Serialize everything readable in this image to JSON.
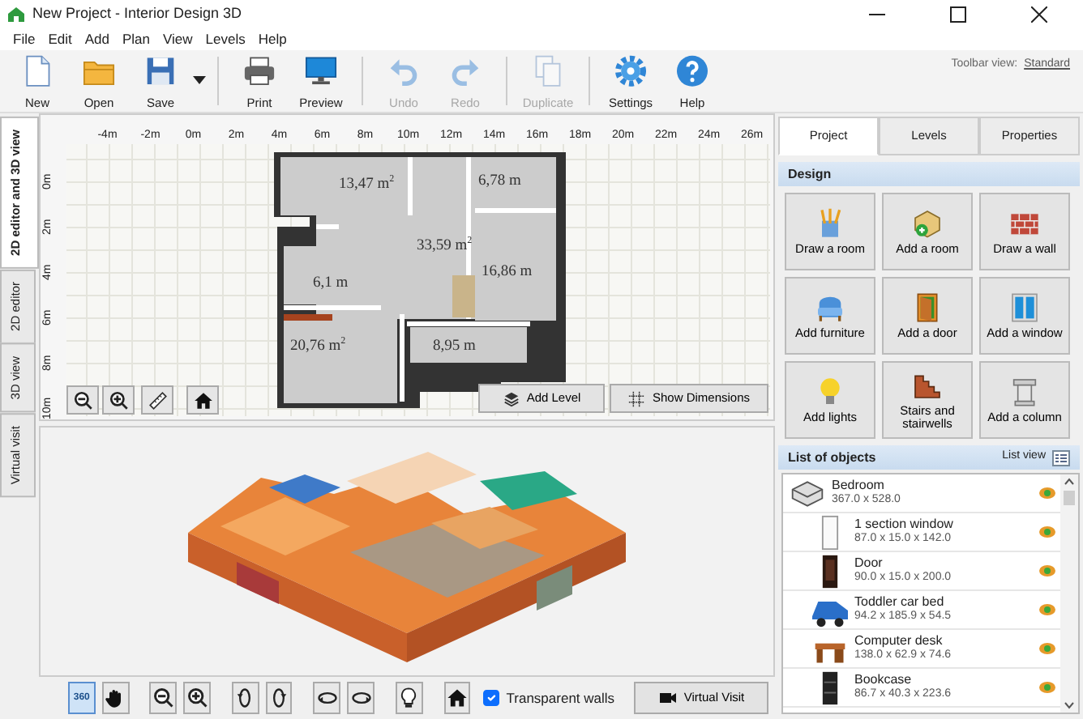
{
  "window": {
    "title": "New Project - Interior Design 3D"
  },
  "menu": [
    "File",
    "Edit",
    "Add",
    "Plan",
    "View",
    "Levels",
    "Help"
  ],
  "toolbar": {
    "groups": [
      [
        {
          "kind": "new",
          "label": "New",
          "disabled": false
        },
        {
          "kind": "open",
          "label": "Open",
          "disabled": false
        },
        {
          "kind": "save",
          "label": "Save",
          "disabled": false,
          "dropdown": true
        }
      ],
      [
        {
          "kind": "print",
          "label": "Print",
          "disabled": false
        },
        {
          "kind": "preview",
          "label": "Preview",
          "disabled": false
        }
      ],
      [
        {
          "kind": "undo",
          "label": "Undo",
          "disabled": true
        },
        {
          "kind": "redo",
          "label": "Redo",
          "disabled": true
        }
      ],
      [
        {
          "kind": "duplicate",
          "label": "Duplicate",
          "disabled": true
        }
      ],
      [
        {
          "kind": "settings",
          "label": "Settings",
          "disabled": false
        },
        {
          "kind": "help",
          "label": "Help",
          "disabled": false
        }
      ]
    ],
    "view_label": "Toolbar view:",
    "view_link": "Standard"
  },
  "side_tabs": [
    {
      "label": "2D editor and 3D view",
      "selected": true
    },
    {
      "label": "2D editor",
      "selected": false
    },
    {
      "label": "3D view",
      "selected": false
    },
    {
      "label": "Virtual visit",
      "selected": false
    }
  ],
  "plan": {
    "x_ruler": [
      "-4m",
      "-2m",
      "0m",
      "2m",
      "4m",
      "6m",
      "8m",
      "10m",
      "12m",
      "14m",
      "16m",
      "18m",
      "20m",
      "22m",
      "24m",
      "26m"
    ],
    "y_ruler": [
      "0m",
      "2m",
      "4m",
      "6m",
      "8m",
      "10m"
    ],
    "rooms": [
      "13,47 m$^{2}$",
      "6,78 m",
      "33,59 m$^{2}$",
      "16,86 m",
      "6,1 m",
      "20,76 m$^{2}$",
      "8,95 m"
    ],
    "tools": [
      {
        "kind": "zoom-out"
      },
      {
        "kind": "zoom-in"
      },
      {
        "kind": "ruler"
      },
      {
        "kind": "home"
      }
    ],
    "buttons": [
      {
        "kind": "levels",
        "label": "Add Level"
      },
      {
        "kind": "dimensions",
        "label": "Show Dimensions"
      }
    ]
  },
  "view3d": {
    "tools": [
      {
        "kind": "rotate360",
        "label": "360",
        "selected": true
      },
      {
        "kind": "pan",
        "selected": false
      },
      {
        "kind": "zoom-out",
        "selected": false
      },
      {
        "kind": "zoom-in",
        "selected": false
      },
      {
        "kind": "rotate-left",
        "selected": false
      },
      {
        "kind": "rotate-right",
        "selected": false
      },
      {
        "kind": "orbit-left",
        "selected": false
      },
      {
        "kind": "orbit-right",
        "selected": false
      },
      {
        "kind": "light",
        "selected": false
      },
      {
        "kind": "home",
        "selected": false
      }
    ],
    "transparent_walls": {
      "label": "Transparent walls",
      "checked": true
    },
    "virtual_visit": "Virtual Visit"
  },
  "panel": {
    "tabs": [
      {
        "label": "Project",
        "selected": true
      },
      {
        "label": "Levels",
        "selected": false
      },
      {
        "label": "Properties",
        "selected": false
      }
    ],
    "design_title": "Design",
    "design_buttons": [
      {
        "kind": "draw-room",
        "label": "Draw a room"
      },
      {
        "kind": "add-room",
        "label": "Add a room"
      },
      {
        "kind": "draw-wall",
        "label": "Draw a wall"
      },
      {
        "kind": "furniture",
        "label": "Add furniture"
      },
      {
        "kind": "door",
        "label": "Add a door"
      },
      {
        "kind": "window",
        "label": "Add a window"
      },
      {
        "kind": "lights",
        "label": "Add lights"
      },
      {
        "kind": "stairs",
        "label": "Stairs and stairwells"
      },
      {
        "kind": "column",
        "label": "Add a column"
      }
    ],
    "objects_title": "List of objects",
    "list_view": "List view",
    "objects": [
      {
        "kind": "room",
        "name": "Bedroom",
        "size": "367.0 x 528.0",
        "visible": true,
        "children": [
          {
            "kind": "window",
            "name": "1 section window",
            "size": "87.0 x 15.0 x 142.0",
            "visible": true
          },
          {
            "kind": "door",
            "name": "Door",
            "size": "90.0 x 15.0 x 200.0",
            "visible": true
          },
          {
            "kind": "bed",
            "name": "Toddler car bed",
            "size": "94.2 x 185.9 x 54.5",
            "visible": true
          },
          {
            "kind": "desk",
            "name": "Computer desk",
            "size": "138.0 x 62.9 x 74.6",
            "visible": true
          },
          {
            "kind": "bookcase",
            "name": "Bookcase",
            "size": "86.7 x 40.3 x 223.6",
            "visible": true
          }
        ]
      }
    ]
  }
}
